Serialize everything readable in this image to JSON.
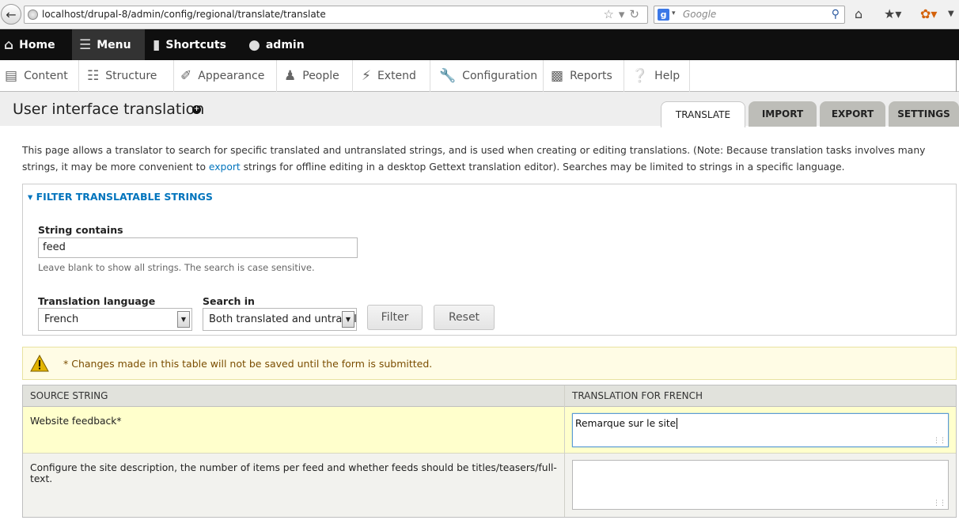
{
  "browser": {
    "url": "localhost/drupal-8/admin/config/regional/translate/translate",
    "search_placeholder": "Google"
  },
  "toolbar": {
    "items": [
      {
        "label": "Home",
        "icon": "home-icon"
      },
      {
        "label": "Menu",
        "icon": "hamburger-icon"
      },
      {
        "label": "Shortcuts",
        "icon": "bookmark-icon"
      },
      {
        "label": "admin",
        "icon": "user-icon"
      }
    ]
  },
  "tray": {
    "items": [
      {
        "label": "Content",
        "icon": "document-icon"
      },
      {
        "label": "Structure",
        "icon": "sitemap-icon"
      },
      {
        "label": "Appearance",
        "icon": "paintbrush-icon"
      },
      {
        "label": "People",
        "icon": "people-icon"
      },
      {
        "label": "Extend",
        "icon": "plug-icon"
      },
      {
        "label": "Configuration",
        "icon": "wrench-icon"
      },
      {
        "label": "Reports",
        "icon": "report-icon"
      },
      {
        "label": "Help",
        "icon": "help-icon"
      }
    ]
  },
  "page": {
    "title": "User interface translation",
    "tabs": [
      {
        "label": "TRANSLATE",
        "active": true
      },
      {
        "label": "IMPORT",
        "active": false
      },
      {
        "label": "EXPORT",
        "active": false
      },
      {
        "label": "SETTINGS",
        "active": false
      }
    ],
    "description_before": "This page allows a translator to search for specific translated and untranslated strings, and is used when creating or editing translations. (Note: Because translation tasks involves many strings, it may be more convenient to ",
    "description_link": "export",
    "description_after": " strings for offline editing in a desktop Gettext translation editor). Searches may be limited to strings in a specific language."
  },
  "filter": {
    "legend": "FILTER TRANSLATABLE STRINGS",
    "string_contains_label": "String contains",
    "string_contains_value": "feed",
    "string_help": "Leave blank to show all strings. The search is case sensitive.",
    "language_label": "Translation language",
    "language_value": "French",
    "search_in_label": "Search in",
    "search_in_value": "Both translated and untranslated strings",
    "filter_button": "Filter",
    "reset_button": "Reset"
  },
  "warning": {
    "text": "* Changes made in this table will not be saved until the form is submitted."
  },
  "table": {
    "headers": [
      "SOURCE STRING",
      "TRANSLATION FOR FRENCH"
    ],
    "rows": [
      {
        "source": "Website feedback*",
        "translation": "Remarque sur le site"
      },
      {
        "source": "Configure the site description, the number of items per feed and whether feeds should be titles/teasers/full-text.",
        "translation": ""
      }
    ]
  },
  "colors": {
    "link": "#0074bd",
    "toolbar_bg": "#0f0f0f",
    "changed_row": "#ffffcc",
    "warning_bg": "#fffce5"
  }
}
